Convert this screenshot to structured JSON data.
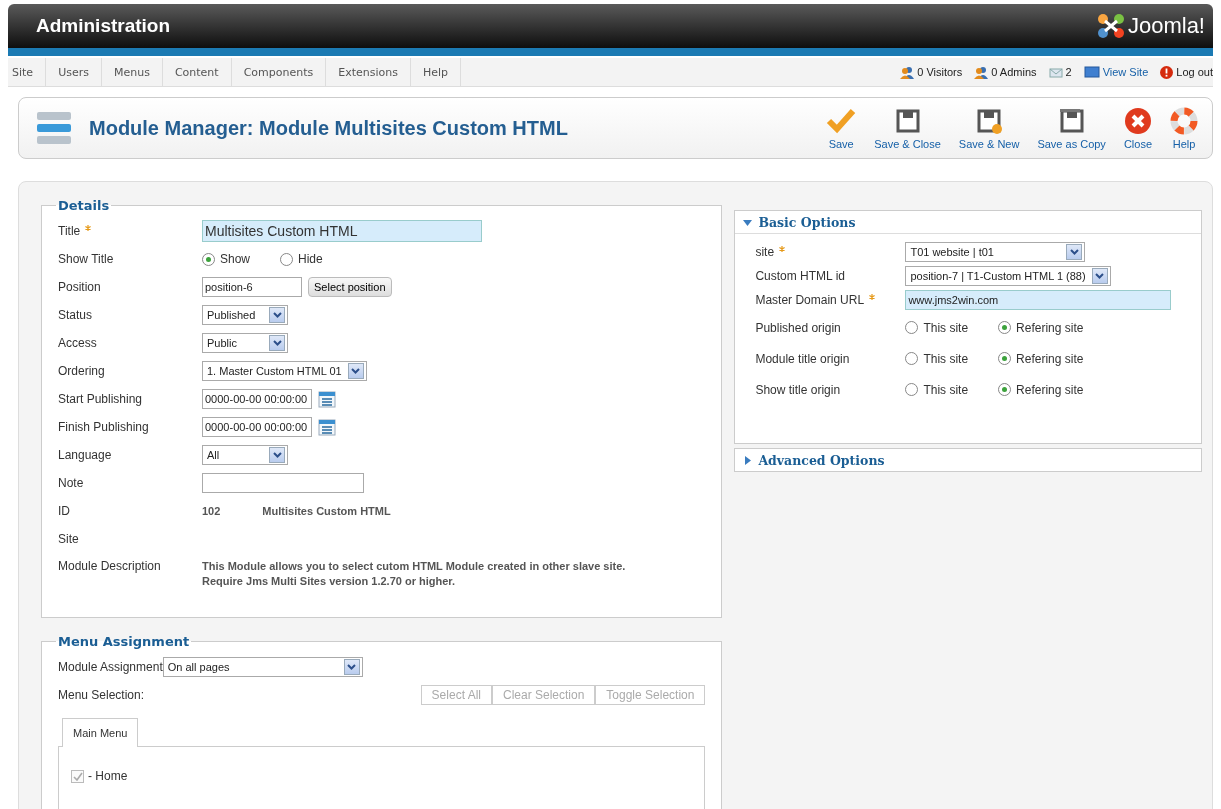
{
  "header": {
    "title": "Administration",
    "logo": "Joomla!"
  },
  "menubar": {
    "items": [
      "Site",
      "Users",
      "Menus",
      "Content",
      "Components",
      "Extensions",
      "Help"
    ],
    "status": [
      {
        "kind": "visitors",
        "text": "0 Visitors"
      },
      {
        "kind": "admins",
        "text": "0 Admins"
      },
      {
        "kind": "messages",
        "text": "2"
      },
      {
        "kind": "viewsite",
        "text": "View Site"
      },
      {
        "kind": "logout",
        "text": "Log out"
      }
    ]
  },
  "toolbar": {
    "title": "Module Manager: Module Multisites Custom HTML",
    "buttons": [
      {
        "kind": "save",
        "label": "Save"
      },
      {
        "kind": "save-close",
        "label": "Save & Close"
      },
      {
        "kind": "save-new",
        "label": "Save & New"
      },
      {
        "kind": "save-copy",
        "label": "Save as Copy"
      },
      {
        "kind": "close",
        "label": "Close"
      },
      {
        "kind": "help",
        "label": "Help"
      }
    ]
  },
  "details": {
    "legend": "Details",
    "fields": [
      {
        "kind": "text",
        "label": "Title",
        "required": true,
        "value": "Multisites Custom HTML"
      },
      {
        "kind": "radio",
        "label": "Show Title",
        "required": false,
        "options": [
          {
            "label": "Show",
            "selected": true
          },
          {
            "label": "Hide",
            "selected": false
          }
        ]
      },
      {
        "kind": "position",
        "label": "Position",
        "required": false,
        "value": "position-6",
        "button": "Select position"
      },
      {
        "kind": "select",
        "label": "Status",
        "required": false,
        "value": "Published"
      },
      {
        "kind": "select",
        "label": "Access",
        "required": false,
        "value": "Public"
      },
      {
        "kind": "select",
        "label": "Ordering",
        "required": false,
        "value": "1. Master Custom HTML 01"
      },
      {
        "kind": "date",
        "label": "Start Publishing",
        "required": false,
        "value": "0000-00-00 00:00:00"
      },
      {
        "kind": "date",
        "label": "Finish Publishing",
        "required": false,
        "value": "0000-00-00 00:00:00"
      },
      {
        "kind": "select",
        "label": "Language",
        "required": false,
        "value": "All"
      },
      {
        "kind": "note",
        "label": "Note",
        "required": false
      },
      {
        "kind": "static",
        "label": "ID",
        "required": false,
        "values": [
          "102",
          "Multisites Custom HTML"
        ]
      },
      {
        "kind": "empty",
        "label": "Site",
        "required": false
      },
      {
        "kind": "description",
        "label": "Module Description",
        "required": false,
        "text": "This Module allows you to select cutom HTML Module created in other slave site.\nRequire Jms Multi Sites version 1.2.70 or higher."
      }
    ]
  },
  "basic_options": {
    "title": "Basic Options",
    "expanded": true,
    "fields": [
      {
        "kind": "select",
        "label": "site",
        "required": true,
        "value": "T01 website | t01"
      },
      {
        "kind": "select",
        "label": "Custom HTML id",
        "required": false,
        "value": "position-7 | T1-Custom HTML 1 (88)"
      },
      {
        "kind": "text",
        "label": "Master Domain URL",
        "required": true,
        "value": "www.jms2win.com"
      },
      {
        "kind": "radio",
        "label": "Published origin",
        "required": false,
        "options": [
          {
            "label": "This site",
            "selected": false
          },
          {
            "label": "Refering site",
            "selected": true
          }
        ]
      },
      {
        "kind": "radio",
        "label": "Module title origin",
        "required": false,
        "options": [
          {
            "label": "This site",
            "selected": false
          },
          {
            "label": "Refering site",
            "selected": true
          }
        ]
      },
      {
        "kind": "radio",
        "label": "Show title origin",
        "required": false,
        "options": [
          {
            "label": "This site",
            "selected": false
          },
          {
            "label": "Refering site",
            "selected": true
          }
        ]
      }
    ]
  },
  "advanced_options": {
    "title": "Advanced Options",
    "expanded": false
  },
  "menu_assignment": {
    "legend": "Menu Assignment",
    "assignment_label": "Module Assignment",
    "assignment_value": "On all pages",
    "selection_label": "Menu Selection:",
    "buttons": [
      "Select All",
      "Clear Selection",
      "Toggle Selection"
    ],
    "tabs": [
      {
        "label": "Main Menu",
        "selected": true
      }
    ],
    "items": [
      {
        "label": "- Home",
        "checked": true
      }
    ]
  }
}
